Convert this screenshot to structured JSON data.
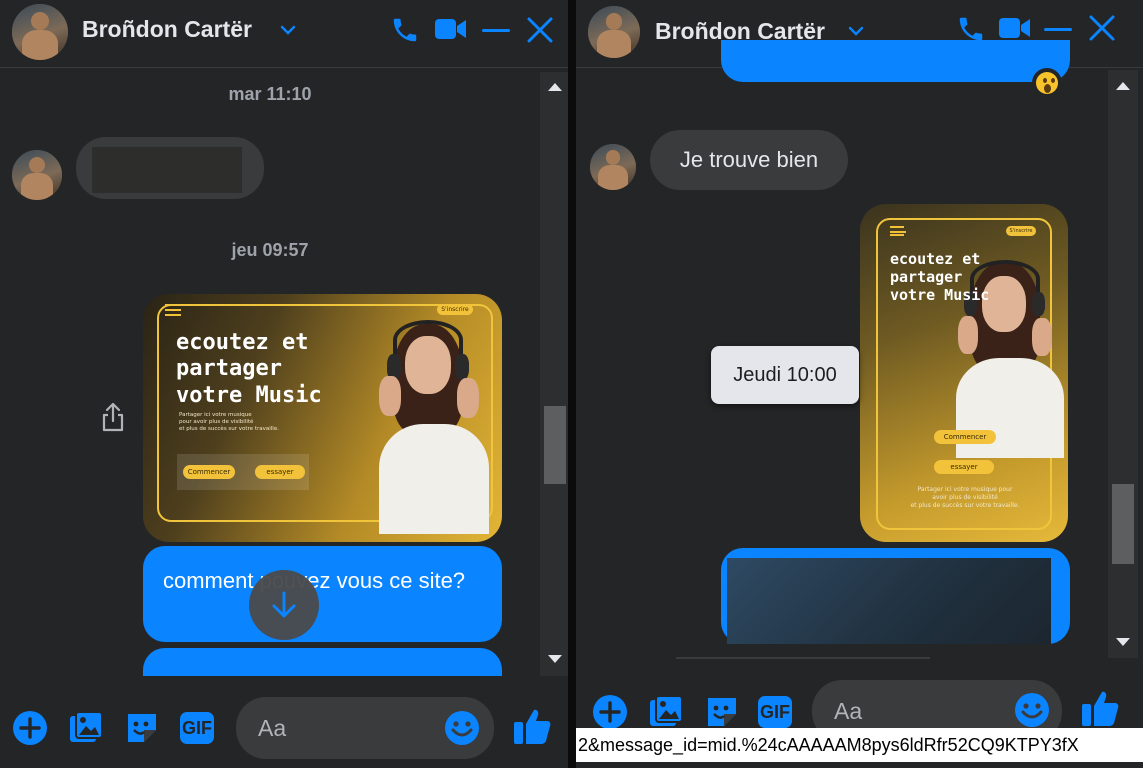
{
  "left": {
    "contact_name": "Broñdon Cartër",
    "timestamp_1": "mar 11:10",
    "timestamp_2": "jeu 09:57",
    "promo": {
      "heading": "ecoutez et\npartager\nvotre Music",
      "badge": "S'inscrire",
      "tagline": "Partager ici votre musique\npour avoir plus de visibilité\net plus de succès sur votre travaille.",
      "button_1": "Commencer",
      "button_2": "essayer"
    },
    "blue_message": "comment pouvez vous ce site?",
    "input_placeholder": "Aa"
  },
  "right": {
    "contact_name": "Broñdon Cartër",
    "received_message": "Je trouve bien",
    "tooltip": "Jeudi 10:00",
    "promo": {
      "heading": "ecoutez et\npartager\nvotre Music",
      "badge": "S'inscrire",
      "button_1": "Commencer",
      "button_2": "essayer",
      "tagline": "Partager ici votre musique pour\navoir plus de visibilité\net plus de succès sur votre travaille."
    },
    "input_placeholder": "Aa"
  },
  "composer": {
    "gif_label": "GIF"
  },
  "status_url": "2&message_id=mid.%24cAAAAAM8pys6ldRfr52CQ9KTPY3fX",
  "colors": {
    "accent": "#0a84ff",
    "panel_bg": "#242526",
    "bubble_grey": "#3a3b3c"
  },
  "icons": [
    "phone-icon",
    "video-icon",
    "minimize-icon",
    "close-icon",
    "chevron-down-icon",
    "plus-icon",
    "image-icon",
    "sticker-icon",
    "gif-icon",
    "emoji-icon",
    "thumbs-up-icon",
    "share-icon",
    "arrow-down-icon",
    "surprised-reaction-icon"
  ]
}
